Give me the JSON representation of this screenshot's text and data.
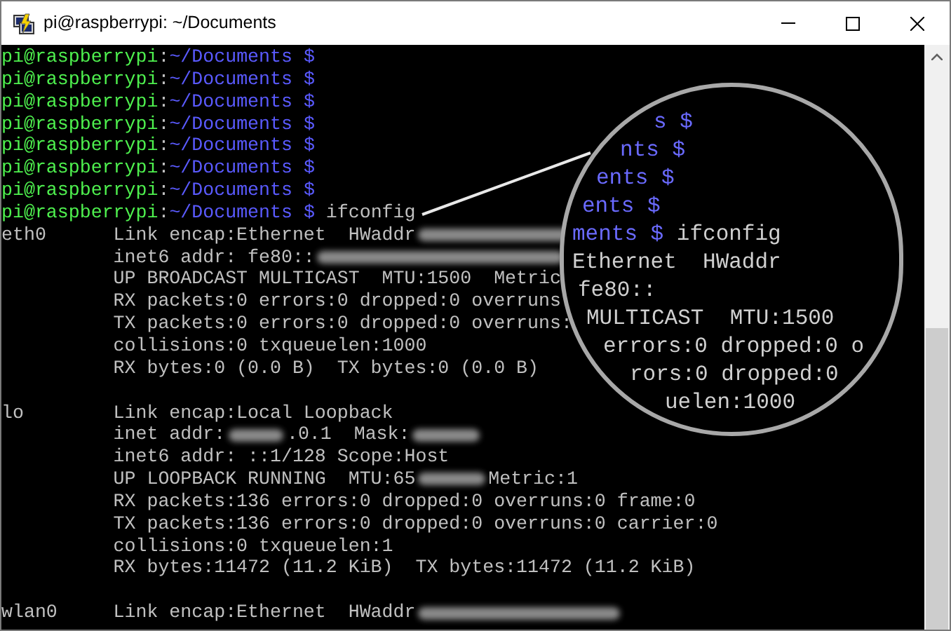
{
  "window": {
    "title": "pi@raspberrypi: ~/Documents"
  },
  "terminal": {
    "prompts": [
      {
        "user": "pi@raspberrypi",
        "separator": ":",
        "path": "~/Documents $"
      },
      {
        "user": "pi@raspberrypi",
        "separator": ":",
        "path": "~/Documents $"
      },
      {
        "user": "pi@raspberrypi",
        "separator": ":",
        "path": "~/Documents $"
      },
      {
        "user": "pi@raspberrypi",
        "separator": ":",
        "path": "~/Documents $"
      },
      {
        "user": "pi@raspberrypi",
        "separator": ":",
        "path": "~/Documents $"
      },
      {
        "user": "pi@raspberrypi",
        "separator": ":",
        "path": "~/Documents $"
      },
      {
        "user": "pi@raspberrypi",
        "separator": ":",
        "path": "~/Documents $"
      },
      {
        "user": "pi@raspberrypi",
        "separator": ":",
        "path": "~/Documents $",
        "command": "ifconfig"
      }
    ],
    "output": [
      {
        "kind": "line",
        "interface": "eth0",
        "segments": [
          {
            "kind": "text",
            "text": "Link encap:Ethernet  HWaddr"
          },
          {
            "kind": "smudge"
          }
        ]
      },
      {
        "kind": "line",
        "segments": [
          {
            "kind": "text",
            "text": "inet6 addr: fe80::"
          },
          {
            "kind": "smudge"
          }
        ]
      },
      {
        "kind": "line",
        "segments": [
          {
            "kind": "text",
            "text": "UP BROADCAST MULTICAST  MTU:1500  Metric"
          }
        ]
      },
      {
        "kind": "line",
        "segments": [
          {
            "kind": "text",
            "text": "RX packets:0 errors:0 dropped:0 overruns"
          }
        ]
      },
      {
        "kind": "line",
        "segments": [
          {
            "kind": "text",
            "text": "TX packets:0 errors:0 dropped:0 overruns:"
          }
        ]
      },
      {
        "kind": "line",
        "segments": [
          {
            "kind": "text",
            "text": "collisions:0 txqueuelen:1000"
          }
        ]
      },
      {
        "kind": "line",
        "segments": [
          {
            "kind": "text",
            "text": "RX bytes:0 (0.0 B)  TX bytes:0 (0.0 B)"
          }
        ]
      },
      {
        "kind": "blank"
      },
      {
        "kind": "line",
        "interface": "lo",
        "segments": [
          {
            "kind": "text",
            "text": "Link encap:Local Loopback"
          }
        ]
      },
      {
        "kind": "line",
        "segments": [
          {
            "kind": "text",
            "text": "inet addr:"
          },
          {
            "kind": "smudge"
          },
          {
            "kind": "text",
            "text": ".0.1  Mask:"
          },
          {
            "kind": "smudge"
          }
        ]
      },
      {
        "kind": "line",
        "segments": [
          {
            "kind": "text",
            "text": "inet6 addr: ::1/128 Scope:Host"
          }
        ]
      },
      {
        "kind": "line",
        "segments": [
          {
            "kind": "text",
            "text": "UP LOOPBACK RUNNING  MTU:65"
          },
          {
            "kind": "smudge"
          },
          {
            "kind": "text",
            "text": "Metric:1"
          }
        ]
      },
      {
        "kind": "line",
        "segments": [
          {
            "kind": "text",
            "text": "RX packets:136 errors:0 dropped:0 overruns:0 frame:0"
          }
        ]
      },
      {
        "kind": "line",
        "segments": [
          {
            "kind": "text",
            "text": "TX packets:136 errors:0 dropped:0 overruns:0 carrier:0"
          }
        ]
      },
      {
        "kind": "line",
        "segments": [
          {
            "kind": "text",
            "text": "collisions:0 txqueuelen:1"
          }
        ]
      },
      {
        "kind": "line",
        "segments": [
          {
            "kind": "text",
            "text": "RX bytes:11472 (11.2 KiB)  TX bytes:11472 (11.2 KiB)"
          }
        ]
      },
      {
        "kind": "blank"
      },
      {
        "kind": "line",
        "interface": "wlan0",
        "segments": [
          {
            "kind": "text",
            "text": "Link encap:Ethernet  HWaddr"
          },
          {
            "kind": "smudge"
          }
        ]
      }
    ]
  },
  "magnifier": {
    "lines": [
      {
        "kind": "path",
        "text": "s $"
      },
      {
        "kind": "path",
        "text": "nts $"
      },
      {
        "kind": "path",
        "text": "ents $"
      },
      {
        "kind": "path",
        "text": "ents $"
      },
      {
        "kind": "path",
        "text": "ments $",
        "command": "ifconfig"
      },
      {
        "kind": "output",
        "text": "Ethernet  HWaddr"
      },
      {
        "kind": "output",
        "text": "fe80::"
      },
      {
        "kind": "output",
        "text": "MULTICAST  MTU:1500"
      },
      {
        "kind": "output",
        "text": "errors:0 dropped:0 o"
      },
      {
        "kind": "output",
        "text": "rors:0 dropped:0"
      },
      {
        "kind": "output",
        "text": "uelen:1000"
      }
    ]
  }
}
